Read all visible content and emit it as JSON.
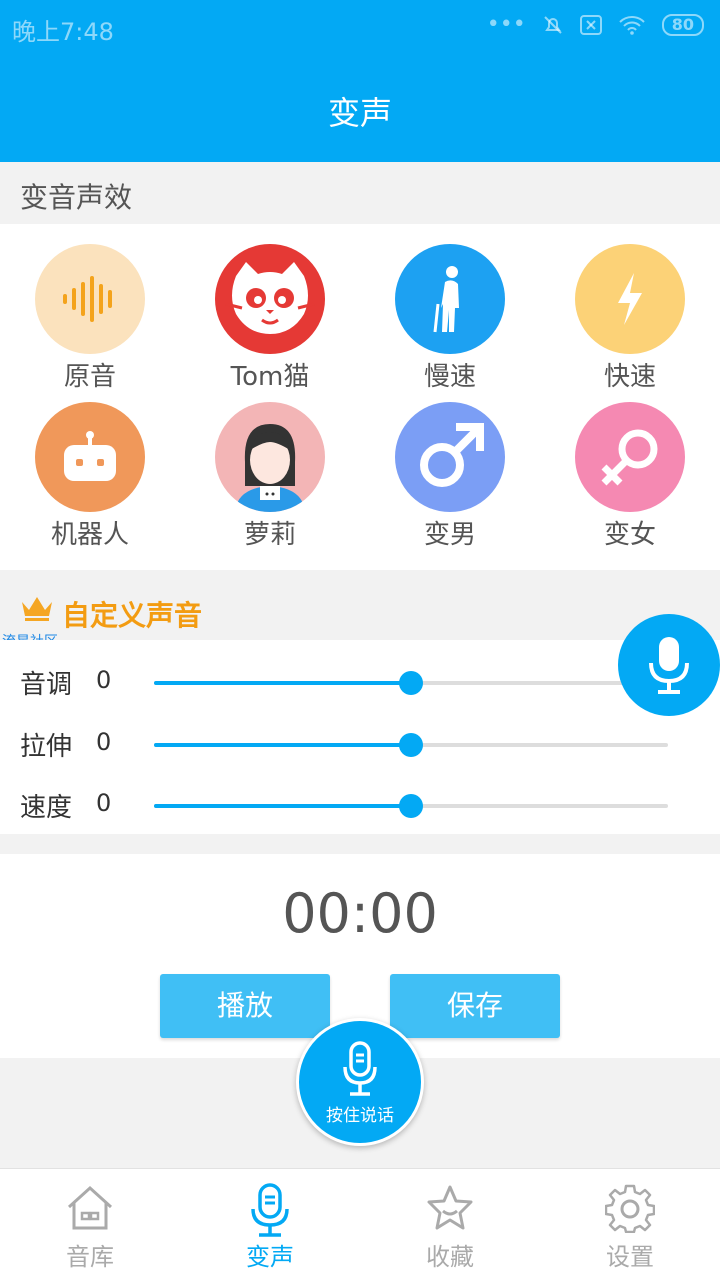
{
  "status_bar": {
    "time": "晚上7:48",
    "dots": "•••",
    "battery": "80"
  },
  "header": {
    "title": "变声"
  },
  "effects_section": {
    "title": "变音声效"
  },
  "effects": [
    {
      "label": "原音",
      "color": "#fbe2bd",
      "icon": "sound-wave-icon"
    },
    {
      "label": "Tom猫",
      "color": "#e53935",
      "icon": "cat-face-icon"
    },
    {
      "label": "慢速",
      "color": "#1da1f2",
      "icon": "old-man-icon"
    },
    {
      "label": "快速",
      "color": "#fcd277",
      "icon": "lightning-icon"
    },
    {
      "label": "机器人",
      "color": "#f0985a",
      "icon": "robot-icon"
    },
    {
      "label": "萝莉",
      "color": "#f3b5b6",
      "icon": "girl-icon"
    },
    {
      "label": "变男",
      "color": "#7b9ef5",
      "icon": "male-symbol-icon"
    },
    {
      "label": "变女",
      "color": "#f589b2",
      "icon": "female-symbol-icon"
    }
  ],
  "custom": {
    "title": "自定义声音",
    "watermark": "流星社区"
  },
  "sliders": [
    {
      "name": "音调",
      "value": "0",
      "fraction": 0.5
    },
    {
      "name": "拉伸",
      "value": "0",
      "fraction": 0.5
    },
    {
      "name": "速度",
      "value": "0",
      "fraction": 0.5
    }
  ],
  "recorder": {
    "time": "00:00",
    "play_label": "播放",
    "save_label": "保存",
    "hold_label": "按住说话"
  },
  "tabs": [
    {
      "label": "音库",
      "icon": "home-icon",
      "active": false
    },
    {
      "label": "变声",
      "icon": "microphone-icon",
      "active": true
    },
    {
      "label": "收藏",
      "icon": "star-icon",
      "active": false
    },
    {
      "label": "设置",
      "icon": "gear-icon",
      "active": false
    }
  ],
  "colors": {
    "primary": "#03a9f4",
    "button": "#40bff5",
    "accent": "#f39c12"
  }
}
